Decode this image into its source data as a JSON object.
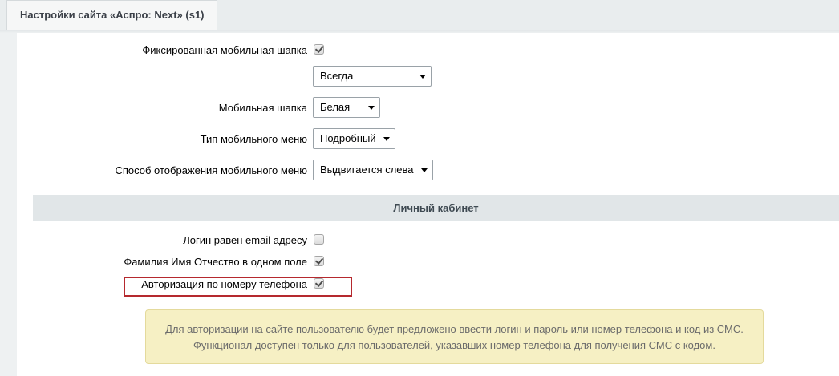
{
  "tab": {
    "title": "Настройки сайта «Аспро: Next» (s1)"
  },
  "mobile": {
    "fixed_header_label": "Фиксированная мобильная шапка",
    "fixed_header_checked": true,
    "fixed_header_mode": "Всегда",
    "header_label": "Мобильная шапка",
    "header_value": "Белая",
    "menu_type_label": "Тип мобильного меню",
    "menu_type_value": "Подробный",
    "menu_display_label": "Способ отображения мобильного меню",
    "menu_display_value": "Выдвигается слева"
  },
  "account": {
    "section_title": "Личный кабинет",
    "login_email_label": "Логин равен email адресу",
    "login_email_checked": false,
    "fio_label": "Фамилия Имя Отчество в одном поле",
    "fio_checked": true,
    "phone_auth_label": "Авторизация по номеру телефона",
    "phone_auth_checked": true,
    "note_line1": "Для авторизации на сайте пользователю будет предложено ввести логин и пароль или номер телефона и код из СМС.",
    "note_line2": "Функционал доступен только для пользователей, указавших номер телефона для получения СМС с кодом."
  },
  "colors": {
    "highlight_border": "#b5292e",
    "note_background": "#f6f0c4",
    "section_header_background": "#e1e6e8"
  }
}
